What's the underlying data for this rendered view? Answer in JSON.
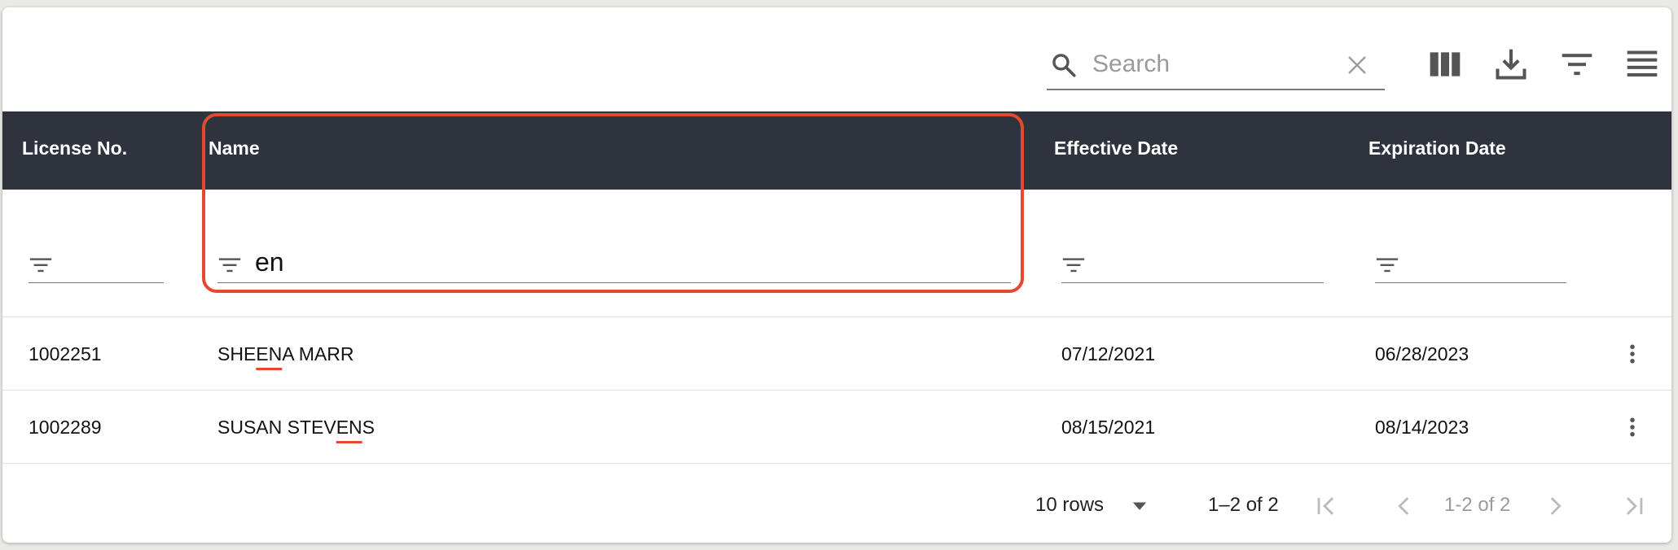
{
  "toolbar": {
    "search_placeholder": "Search",
    "search_value": "",
    "icons": [
      "search-icon",
      "clear-icon",
      "view-columns-icon",
      "download-icon",
      "filter-list-icon",
      "density-icon"
    ]
  },
  "table": {
    "columns": [
      {
        "label": "License No.",
        "filter": ""
      },
      {
        "label": "Name",
        "filter": "en"
      },
      {
        "label": "Effective Date",
        "filter": ""
      },
      {
        "label": "Expiration Date",
        "filter": ""
      }
    ],
    "rows": [
      {
        "license": "1002251",
        "name_pre": "SHE",
        "name_match": "EN",
        "name_post": "A MARR",
        "effective": "07/12/2021",
        "expiration": "06/28/2023"
      },
      {
        "license": "1002289",
        "name_pre": "SUSAN STEV",
        "name_match": "EN",
        "name_post": "S",
        "effective": "08/15/2021",
        "expiration": "08/14/2023"
      }
    ]
  },
  "footer": {
    "rows_per_page": "10 rows",
    "range": "1–2 of 2",
    "page_label": "1-2 of 2"
  },
  "colors": {
    "header_bg": "#2e333d",
    "highlight": "#e5482e"
  }
}
